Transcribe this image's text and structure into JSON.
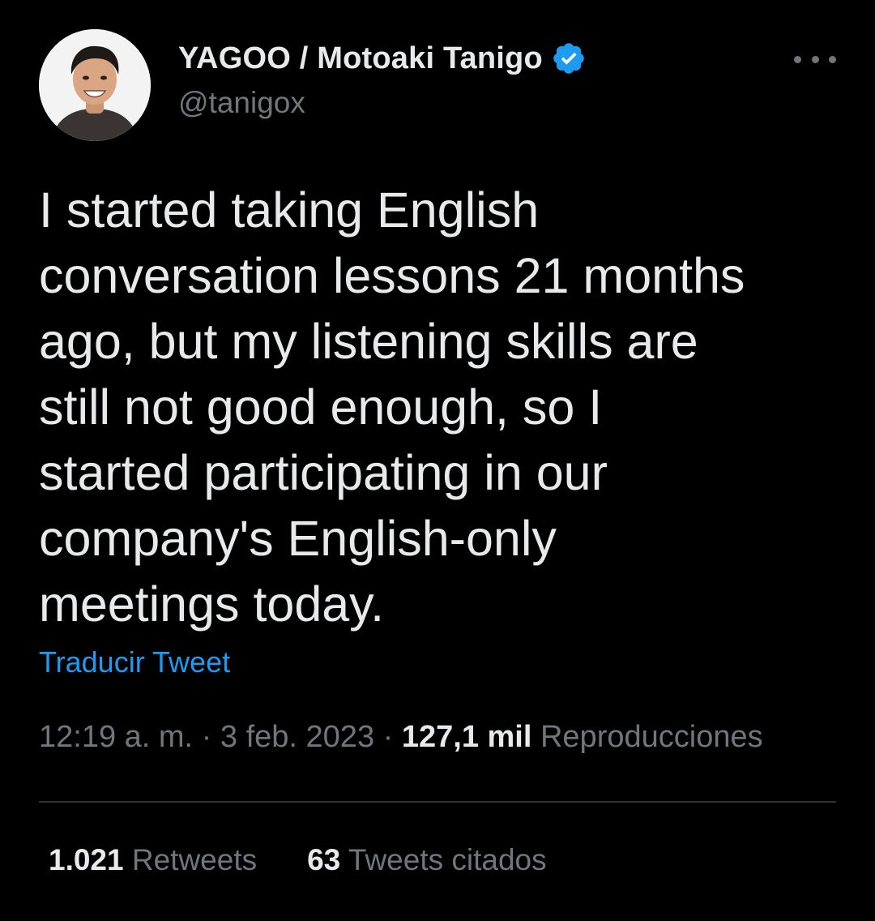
{
  "author": {
    "display_name": "YAGOO / Motoaki Tanigo",
    "handle": "@tanigox",
    "verified": true,
    "verified_color": "#1d9bf0"
  },
  "tweet": {
    "lines": [
      "I started taking English",
      "conversation lessons 21 months",
      "ago, but my listening skills are",
      "still not good enough, so I",
      "started participating in our",
      "company's English-only",
      "meetings today."
    ]
  },
  "translate_label": "Traducir Tweet",
  "meta": {
    "time": "12:19 a. m.",
    "sep1": " · ",
    "date": "3 feb. 2023",
    "sep2": " · ",
    "views_count": "127,1 mil",
    "views_label": "Reproducciones"
  },
  "stats": {
    "retweets_count": "1.021",
    "retweets_label": "Retweets",
    "quotes_count": "63",
    "quotes_label": "Tweets citados"
  },
  "colors": {
    "background": "#000000",
    "text_primary": "#e7e9ea",
    "text_secondary": "#71767b",
    "link": "#1d9bf0",
    "divider": "#2f3336"
  }
}
